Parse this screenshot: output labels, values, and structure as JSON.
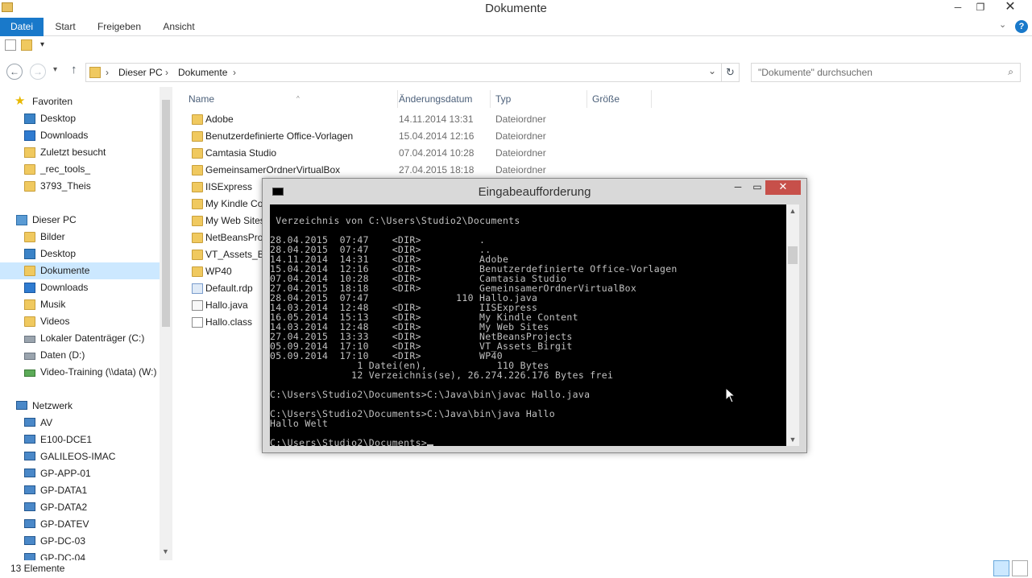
{
  "window": {
    "title": "Dokumente",
    "min_glyph": "─",
    "max_glyph": "❐",
    "close_glyph": "✕"
  },
  "ribbon": {
    "tabs": [
      "Datei",
      "Start",
      "Freigeben",
      "Ansicht"
    ],
    "help_glyph": "?",
    "collapse_glyph": "⌄"
  },
  "address": {
    "back_glyph": "←",
    "forward_glyph": "→",
    "recent_glyph": "▾",
    "up_glyph": "↑",
    "crumbs": [
      "Dieser PC",
      "Dokumente"
    ],
    "crumb_sep": "›",
    "dropdown_glyph": "⌄",
    "refresh_glyph": "↻",
    "search_placeholder": "\"Dokumente\" durchsuchen",
    "search_glyph": "⌕"
  },
  "nav": {
    "favorites_label": "Favoriten",
    "favorites": [
      "Desktop",
      "Downloads",
      "Zuletzt besucht",
      "_rec_tools_",
      "3793_Theis"
    ],
    "this_pc_label": "Dieser PC",
    "this_pc": [
      "Bilder",
      "Desktop",
      "Dokumente",
      "Downloads",
      "Musik",
      "Videos",
      "Lokaler Datenträger (C:)",
      "Daten (D:)",
      "Video-Training (\\\\data) (W:)"
    ],
    "network_label": "Netzwerk",
    "network": [
      "AV",
      "E100-DCE1",
      "GALILEOS-IMAC",
      "GP-APP-01",
      "GP-DATA1",
      "GP-DATA2",
      "GP-DATEV",
      "GP-DC-03",
      "GP-DC-04"
    ]
  },
  "filelist": {
    "columns": [
      "Name",
      "Änderungsdatum",
      "Typ",
      "Größe"
    ],
    "sort_glyph": "^",
    "rows": [
      {
        "name": "Adobe",
        "date": "14.11.2014 13:31",
        "type": "Dateiordner",
        "kind": "folder"
      },
      {
        "name": "Benutzerdefinierte Office-Vorlagen",
        "date": "15.04.2014 12:16",
        "type": "Dateiordner",
        "kind": "folder"
      },
      {
        "name": "Camtasia Studio",
        "date": "07.04.2014 10:28",
        "type": "Dateiordner",
        "kind": "folder"
      },
      {
        "name": "GemeinsamerOrdnerVirtualBox",
        "date": "27.04.2015 18:18",
        "type": "Dateiordner",
        "kind": "folder"
      },
      {
        "name": "IISExpress",
        "date": "",
        "type": "",
        "kind": "folder"
      },
      {
        "name": "My Kindle Co",
        "date": "",
        "type": "",
        "kind": "folder"
      },
      {
        "name": "My Web Sites",
        "date": "",
        "type": "",
        "kind": "folder"
      },
      {
        "name": "NetBeansProj",
        "date": "",
        "type": "",
        "kind": "folder"
      },
      {
        "name": "VT_Assets_Bir",
        "date": "",
        "type": "",
        "kind": "folder"
      },
      {
        "name": "WP40",
        "date": "",
        "type": "",
        "kind": "folder"
      },
      {
        "name": "Default.rdp",
        "date": "",
        "type": "",
        "kind": "file-rdp"
      },
      {
        "name": "Hallo.java",
        "date": "",
        "type": "",
        "kind": "file-java"
      },
      {
        "name": "Hallo.class",
        "date": "",
        "type": "",
        "kind": "file-class"
      }
    ]
  },
  "status": {
    "count": "13 Elemente"
  },
  "console": {
    "title": "Eingabeaufforderung",
    "min_glyph": "─",
    "max_glyph": "▭",
    "close_glyph": "✕",
    "scroll_up_glyph": "▲",
    "scroll_down_glyph": "▼",
    "lines": [
      "",
      " Verzeichnis von C:\\Users\\Studio2\\Documents",
      "",
      "28.04.2015  07:47    <DIR>          .",
      "28.04.2015  07:47    <DIR>          ..",
      "14.11.2014  14:31    <DIR>          Adobe",
      "15.04.2014  12:16    <DIR>          Benutzerdefinierte Office-Vorlagen",
      "07.04.2014  10:28    <DIR>          Camtasia Studio",
      "27.04.2015  18:18    <DIR>          GemeinsamerOrdnerVirtualBox",
      "28.04.2015  07:47               110 Hallo.java",
      "14.03.2014  12:48    <DIR>          IISExpress",
      "16.05.2014  15:13    <DIR>          My Kindle Content",
      "14.03.2014  12:48    <DIR>          My Web Sites",
      "27.04.2015  13:33    <DIR>          NetBeansProjects",
      "05.09.2014  17:10    <DIR>          VT_Assets_Birgit",
      "05.09.2014  17:10    <DIR>          WP40",
      "               1 Datei(en),            110 Bytes",
      "              12 Verzeichnis(se), 26.274.226.176 Bytes frei",
      "",
      "C:\\Users\\Studio2\\Documents>C:\\Java\\bin\\javac Hallo.java",
      "",
      "C:\\Users\\Studio2\\Documents>C:\\Java\\bin\\java Hallo",
      "Hallo Welt",
      "",
      "C:\\Users\\Studio2\\Documents>"
    ]
  }
}
